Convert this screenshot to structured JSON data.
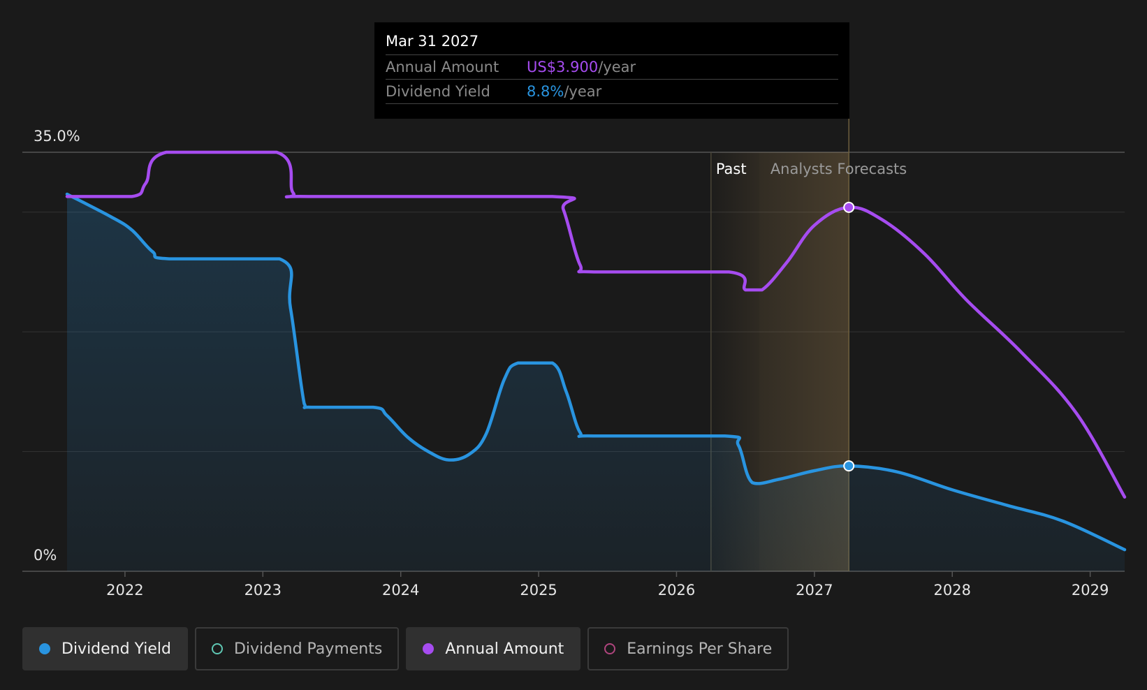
{
  "tooltip": {
    "date": "Mar 31 2027",
    "rows": [
      {
        "label": "Annual Amount",
        "value": "US$3.900",
        "unit": "/year",
        "color": "#a64cf0"
      },
      {
        "label": "Dividend Yield",
        "value": "8.8%",
        "unit": "/year",
        "color": "#2994e0"
      }
    ]
  },
  "legend": [
    {
      "label": "Dividend Yield",
      "color": "#2994e0",
      "filled": true,
      "active": true
    },
    {
      "label": "Dividend Payments",
      "color": "#5fc8b4",
      "filled": false,
      "active": false
    },
    {
      "label": "Annual Amount",
      "color": "#a64cf0",
      "filled": true,
      "active": true
    },
    {
      "label": "Earnings Per Share",
      "color": "#b0457e",
      "filled": false,
      "active": false
    }
  ],
  "chart_data": {
    "type": "line",
    "y_axis_labels": {
      "top": "35.0%",
      "bottom": "0%"
    },
    "ylim": [
      0,
      35
    ],
    "xlim": [
      2021.58,
      2029.25
    ],
    "x_ticks": [
      2022,
      2023,
      2024,
      2025,
      2026,
      2027,
      2028,
      2029
    ],
    "regions": {
      "past_label": "Past",
      "forecast_label": "Analysts Forecasts",
      "past_start": 2026.25,
      "forecast_start": 2026.6,
      "highlight_end": 2027.25
    },
    "highlight_x": 2027.25,
    "series": [
      {
        "name": "Dividend Yield",
        "color": "#2994e0",
        "area": true,
        "points": [
          [
            2021.58,
            31.5
          ],
          [
            2021.9,
            29.6
          ],
          [
            2022.05,
            28.5
          ],
          [
            2022.2,
            26.7
          ],
          [
            2022.32,
            26.1
          ],
          [
            2023.12,
            26.1
          ],
          [
            2023.2,
            22.0
          ],
          [
            2023.3,
            14.0
          ],
          [
            2023.35,
            13.7
          ],
          [
            2023.8,
            13.7
          ],
          [
            2023.9,
            13.0
          ],
          [
            2024.05,
            11.2
          ],
          [
            2024.2,
            10.0
          ],
          [
            2024.35,
            9.3
          ],
          [
            2024.5,
            9.8
          ],
          [
            2024.62,
            11.5
          ],
          [
            2024.75,
            16.0
          ],
          [
            2024.85,
            17.4
          ],
          [
            2025.1,
            17.4
          ],
          [
            2025.2,
            15.0
          ],
          [
            2025.3,
            11.6
          ],
          [
            2025.4,
            11.3
          ],
          [
            2026.35,
            11.3
          ],
          [
            2026.45,
            10.5
          ],
          [
            2026.55,
            7.4
          ],
          [
            2026.75,
            7.7
          ],
          [
            2027.0,
            8.4
          ],
          [
            2027.25,
            8.8
          ],
          [
            2027.6,
            8.3
          ],
          [
            2028.0,
            6.8
          ],
          [
            2028.4,
            5.5
          ],
          [
            2028.8,
            4.2
          ],
          [
            2029.25,
            1.8
          ]
        ]
      },
      {
        "name": "Annual Amount",
        "color": "#a64cf0",
        "area": false,
        "points": [
          [
            2021.58,
            31.3
          ],
          [
            2022.05,
            31.3
          ],
          [
            2022.15,
            32.4
          ],
          [
            2022.3,
            35.0
          ],
          [
            2023.1,
            35.0
          ],
          [
            2023.22,
            31.6
          ],
          [
            2023.35,
            31.3
          ],
          [
            2025.1,
            31.3
          ],
          [
            2025.18,
            30.2
          ],
          [
            2025.3,
            25.6
          ],
          [
            2025.4,
            25.0
          ],
          [
            2026.38,
            25.0
          ],
          [
            2026.5,
            23.5
          ],
          [
            2026.62,
            23.5
          ],
          [
            2026.8,
            25.8
          ],
          [
            2027.0,
            28.9
          ],
          [
            2027.25,
            30.4
          ],
          [
            2027.5,
            29.3
          ],
          [
            2027.8,
            26.5
          ],
          [
            2028.1,
            22.7
          ],
          [
            2028.5,
            18.3
          ],
          [
            2028.9,
            13.2
          ],
          [
            2029.25,
            6.2
          ]
        ]
      }
    ]
  }
}
